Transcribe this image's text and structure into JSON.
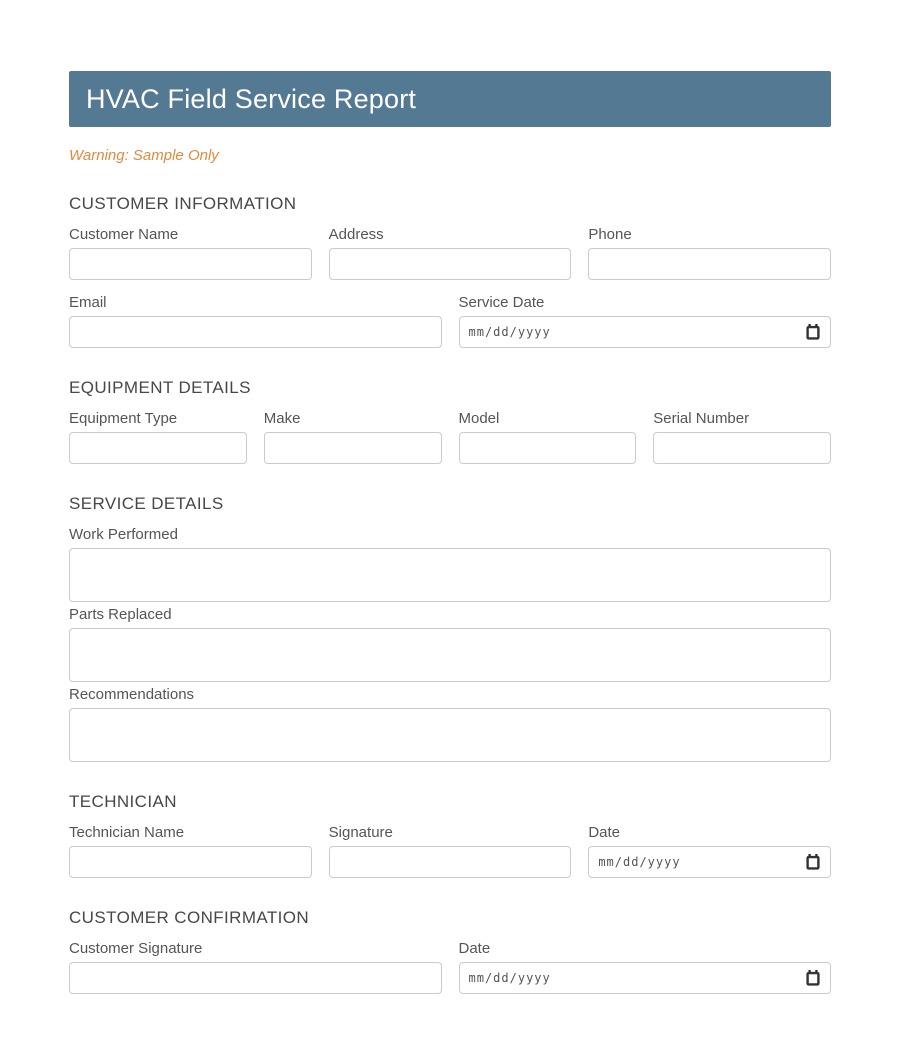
{
  "header": {
    "title": "HVAC Field Service Report"
  },
  "warning": "Warning: Sample Only",
  "date_input": {
    "placeholder": "mm/dd/yyyy"
  },
  "input_value": "",
  "sections": {
    "customer": {
      "title": "CUSTOMER INFORMATION",
      "fields": {
        "customer_name": "Customer Name",
        "address": "Address",
        "phone": "Phone",
        "email": "Email",
        "service_date": "Service Date"
      }
    },
    "equipment": {
      "title": "EQUIPMENT DETAILS",
      "fields": {
        "equipment_type": "Equipment Type",
        "make": "Make",
        "model": "Model",
        "serial_number": "Serial Number"
      }
    },
    "service": {
      "title": "SERVICE DETAILS",
      "fields": {
        "work_performed": "Work Performed",
        "parts_replaced": "Parts Replaced",
        "recommendations": "Recommendations"
      }
    },
    "technician": {
      "title": "TECHNICIAN",
      "fields": {
        "technician_name": "Technician Name",
        "signature": "Signature",
        "date": "Date"
      }
    },
    "confirmation": {
      "title": "CUSTOMER CONFIRMATION",
      "fields": {
        "customer_signature": "Customer Signature",
        "date": "Date"
      }
    }
  },
  "colors": {
    "header_bg": "#547993",
    "header_text": "#FFFFFF",
    "warning_text": "#E18A3D",
    "section_title": "#474747",
    "label_text": "#555555",
    "input_border": "#CBCBCB"
  }
}
